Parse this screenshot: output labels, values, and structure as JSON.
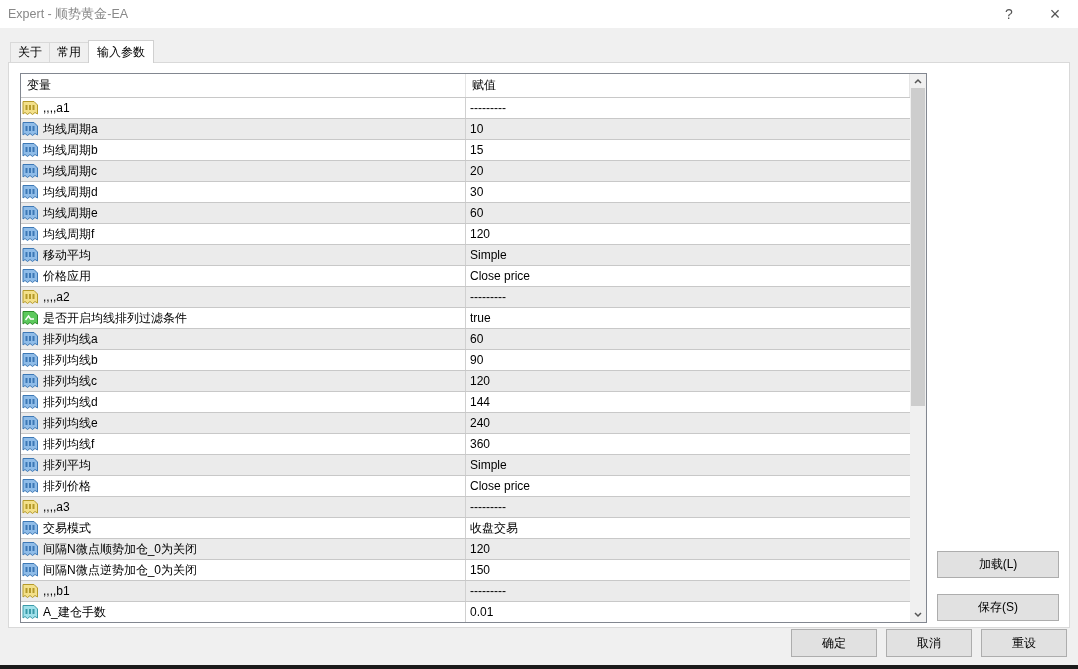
{
  "window": {
    "title": "Expert - 顺势黄金-EA",
    "help": "?",
    "close": "×"
  },
  "tabs": [
    {
      "label": "关于",
      "selected": false
    },
    {
      "label": "常用",
      "selected": false
    },
    {
      "label": "输入参数",
      "selected": true
    }
  ],
  "table": {
    "columns": [
      "变量",
      "赋值"
    ],
    "rows": [
      {
        "kind": "string",
        "name": ",,,,a1",
        "value": "---------"
      },
      {
        "kind": "int",
        "name": "均线周期a",
        "value": "10"
      },
      {
        "kind": "int",
        "name": "均线周期b",
        "value": "15"
      },
      {
        "kind": "int",
        "name": "均线周期c",
        "value": "20"
      },
      {
        "kind": "int",
        "name": "均线周期d",
        "value": "30"
      },
      {
        "kind": "int",
        "name": "均线周期e",
        "value": "60"
      },
      {
        "kind": "int",
        "name": "均线周期f",
        "value": "120"
      },
      {
        "kind": "int",
        "name": "移动平均",
        "value": "Simple"
      },
      {
        "kind": "int",
        "name": "价格应用",
        "value": "Close price"
      },
      {
        "kind": "string",
        "name": ",,,,a2",
        "value": "---------"
      },
      {
        "kind": "bool",
        "name": "是否开启均线排列过滤条件",
        "value": "true"
      },
      {
        "kind": "int",
        "name": "排列均线a",
        "value": "60"
      },
      {
        "kind": "int",
        "name": "排列均线b",
        "value": "90"
      },
      {
        "kind": "int",
        "name": "排列均线c",
        "value": "120"
      },
      {
        "kind": "int",
        "name": "排列均线d",
        "value": "144"
      },
      {
        "kind": "int",
        "name": "排列均线e",
        "value": "240"
      },
      {
        "kind": "int",
        "name": "排列均线f",
        "value": "360"
      },
      {
        "kind": "int",
        "name": "排列平均",
        "value": "Simple"
      },
      {
        "kind": "int",
        "name": "排列价格",
        "value": "Close price"
      },
      {
        "kind": "string",
        "name": ",,,,a3",
        "value": "---------"
      },
      {
        "kind": "int",
        "name": "交易模式",
        "value": "收盘交易"
      },
      {
        "kind": "int",
        "name": "间隔N微点顺势加仓_0为关闭",
        "value": "120"
      },
      {
        "kind": "int",
        "name": "间隔N微点逆势加仓_0为关闭",
        "value": "150"
      },
      {
        "kind": "string",
        "name": ",,,,b1",
        "value": "---------"
      },
      {
        "kind": "double",
        "name": "A_建仓手数",
        "value": "0.01"
      }
    ]
  },
  "side_buttons": [
    "加载(L)",
    "保存(S)"
  ],
  "buttons": [
    "确定",
    "取消",
    "重设"
  ]
}
